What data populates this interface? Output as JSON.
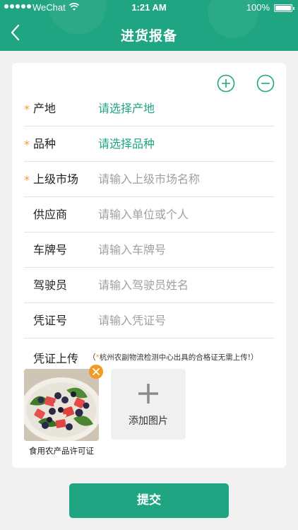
{
  "status_bar": {
    "carrier": "WeChat",
    "time": "1:21 AM",
    "battery": "100%"
  },
  "header": {
    "title": "进货报备"
  },
  "form": {
    "rows": [
      {
        "label": "产地",
        "value": "请选择产地",
        "required": true,
        "kind": "select"
      },
      {
        "label": "品种",
        "value": "请选择品种",
        "required": true,
        "kind": "select"
      },
      {
        "label": "上级市场",
        "placeholder": "请输入上级市场名称",
        "required": true,
        "kind": "input"
      },
      {
        "label": "供应商",
        "placeholder": "请输入单位或个人",
        "required": false,
        "kind": "input"
      },
      {
        "label": "车牌号",
        "placeholder": "请输入车牌号",
        "required": false,
        "kind": "input"
      },
      {
        "label": "驾驶员",
        "placeholder": "请输入驾驶员姓名",
        "required": false,
        "kind": "input"
      },
      {
        "label": "凭证号",
        "placeholder": "请输入凭证号",
        "required": false,
        "kind": "input"
      }
    ],
    "required_mark": "*",
    "upload": {
      "label": "凭证上传",
      "note_open": "（",
      "note_star": "*",
      "note_text": "杭州农副物流检测中心出具的合格证无需上传!）",
      "photo_caption": "食用农产品许可证",
      "add_label": "添加图片"
    }
  },
  "submit_label": "提交",
  "colors": {
    "brand": "#1fa581",
    "required": "#f0a030",
    "remove_badge": "#f39a25"
  }
}
